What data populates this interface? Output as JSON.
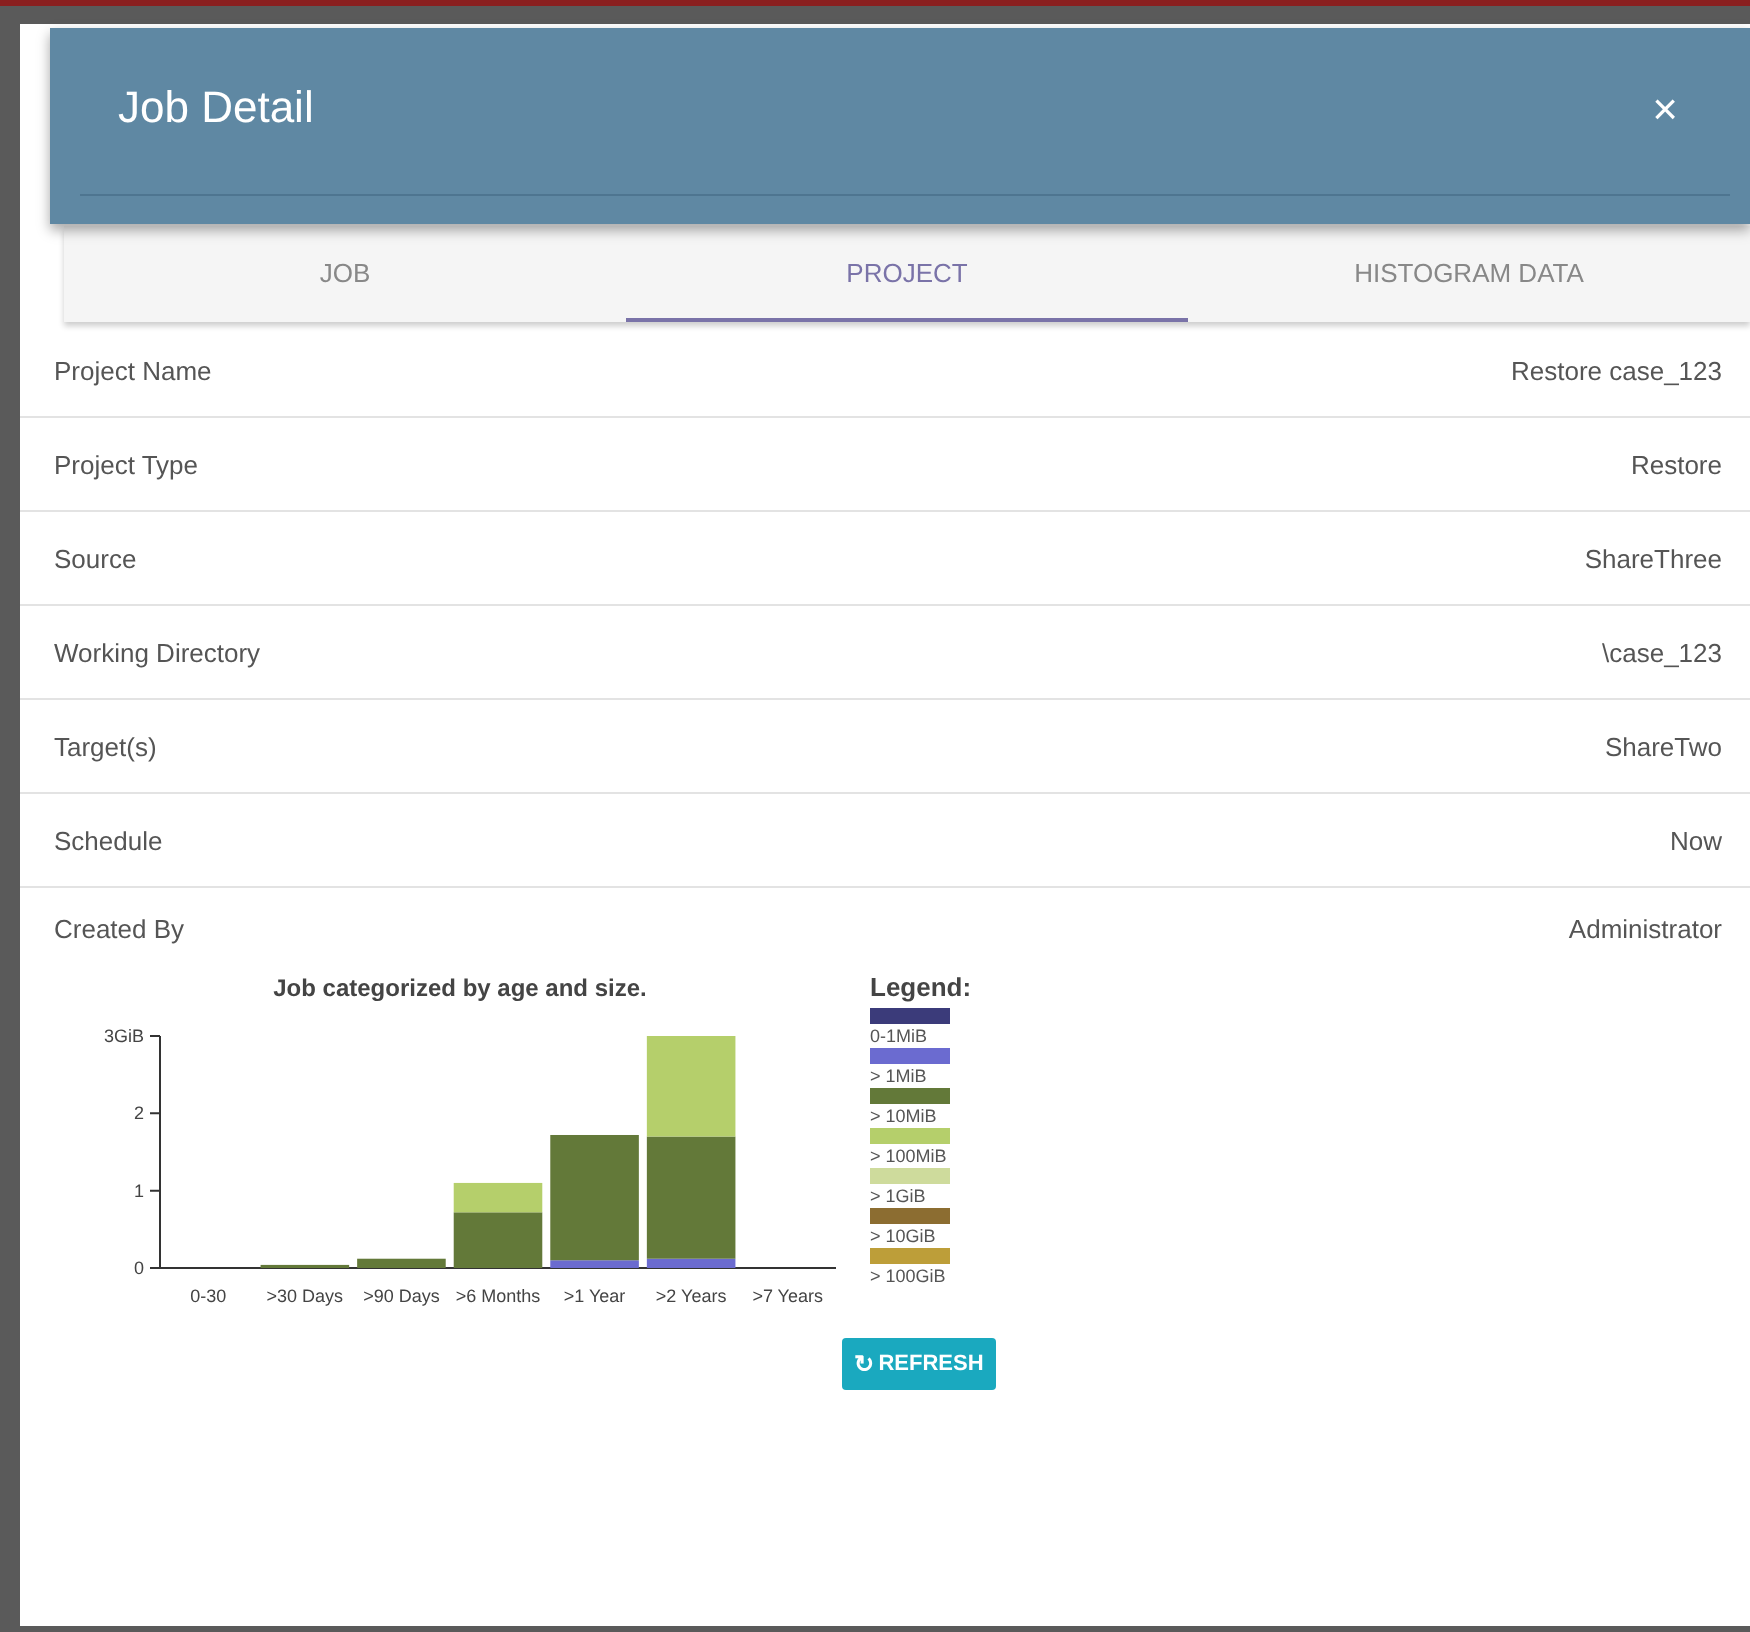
{
  "dialog": {
    "title": "Job Detail",
    "close": "×"
  },
  "tabs": [
    {
      "label": "JOB",
      "selected": false
    },
    {
      "label": "PROJECT",
      "selected": true
    },
    {
      "label": "HISTOGRAM DATA",
      "selected": false
    }
  ],
  "details": [
    {
      "label": "Project Name",
      "value": "Restore case_123"
    },
    {
      "label": "Project Type",
      "value": "Restore"
    },
    {
      "label": "Source",
      "value": "ShareThree"
    },
    {
      "label": "Working Directory",
      "value": "\\case_123"
    },
    {
      "label": "Target(s)",
      "value": "ShareTwo"
    },
    {
      "label": "Schedule",
      "value": "Now"
    },
    {
      "label": "Created By",
      "value": "Administrator"
    }
  ],
  "chart": {
    "legend_title": "Legend:",
    "chart_data": {
      "type": "bar",
      "stacked": true,
      "title": "Job categorized by age and size.",
      "categories": [
        "0-30",
        ">30 Days",
        ">90 Days",
        ">6 Months",
        ">1 Year",
        ">2 Years",
        ">7 Years"
      ],
      "ylim": [
        0,
        3
      ],
      "yticks": [
        0,
        1,
        2,
        {
          "value": 3,
          "label": "3GiB"
        }
      ],
      "series": [
        {
          "name": "0-1MiB",
          "color": "#3b3b7a",
          "values": [
            0,
            0,
            0,
            0,
            0,
            0,
            0
          ]
        },
        {
          "name": "> 1MiB",
          "color": "#6b6bd0",
          "values": [
            0,
            0,
            0,
            0,
            0.1,
            0.12,
            0
          ]
        },
        {
          "name": "> 10MiB",
          "color": "#637939",
          "values": [
            0,
            0.04,
            0.12,
            0.72,
            1.62,
            1.58,
            0
          ]
        },
        {
          "name": "> 100MiB",
          "color": "#b5cf6b",
          "values": [
            0,
            0,
            0,
            0.38,
            0,
            1.3,
            0
          ]
        },
        {
          "name": "> 1GiB",
          "color": "#cedb9c",
          "values": [
            0,
            0,
            0,
            0,
            0,
            0,
            0
          ]
        },
        {
          "name": "> 10GiB",
          "color": "#8c6d31",
          "values": [
            0,
            0,
            0,
            0,
            0,
            0,
            0
          ]
        },
        {
          "name": "> 100GiB",
          "color": "#bd9e39",
          "values": [
            0,
            0,
            0,
            0,
            0,
            0,
            0
          ]
        }
      ]
    }
  },
  "refresh_button": {
    "icon": "↻",
    "label": "REFRESH"
  }
}
